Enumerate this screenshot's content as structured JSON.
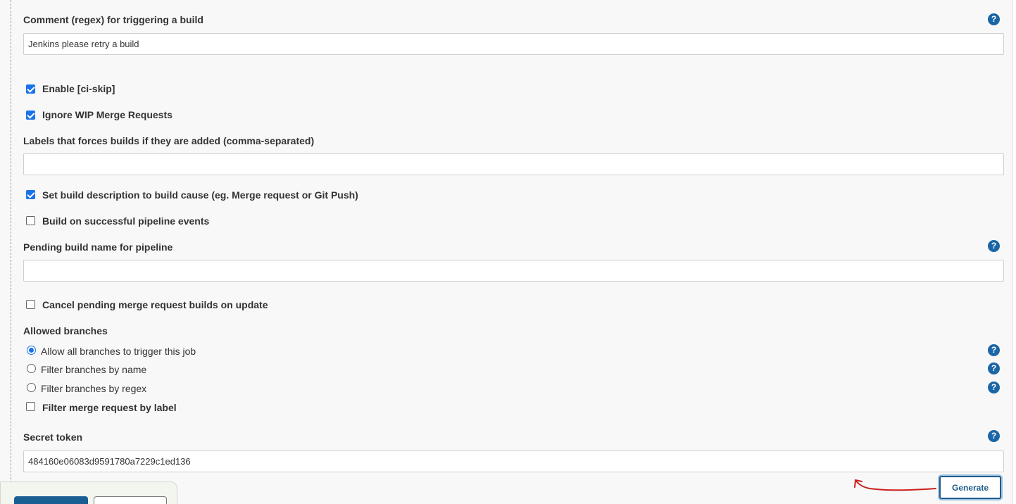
{
  "comment_trigger": {
    "label": "Comment (regex) for triggering a build",
    "value": "Jenkins please retry a build",
    "help_icon": "question-circle-icon"
  },
  "options": {
    "enable_ci_skip": {
      "label": "Enable [ci-skip]",
      "checked": true
    },
    "ignore_wip": {
      "label": "Ignore WIP Merge Requests",
      "checked": true
    },
    "set_build_description": {
      "label": "Set build description to build cause (eg. Merge request or Git Push)",
      "checked": true
    },
    "build_on_pipeline": {
      "label": "Build on successful pipeline events",
      "checked": false
    },
    "cancel_pending": {
      "label": "Cancel pending merge request builds on update",
      "checked": false
    }
  },
  "labels_force_builds": {
    "label": "Labels that forces builds if they are added (comma-separated)",
    "value": ""
  },
  "pending_build_name": {
    "label": "Pending build name for pipeline",
    "value": ""
  },
  "allowed_branches": {
    "title": "Allowed branches",
    "options": [
      {
        "label": "Allow all branches to trigger this job",
        "selected": true
      },
      {
        "label": "Filter branches by name",
        "selected": false
      },
      {
        "label": "Filter branches by regex",
        "selected": false
      }
    ],
    "filter_by_label": {
      "label": "Filter merge request by label",
      "checked": false
    }
  },
  "secret_token": {
    "label": "Secret token",
    "value": "484160e06083d9591780a7229c1ed136",
    "generate_label": "Generate"
  },
  "colors": {
    "accent": "#1a73e8",
    "help_icon": "#1a66a6",
    "annotation_arrow": "#cc1f1f",
    "primary_button": "#1a5f94"
  }
}
